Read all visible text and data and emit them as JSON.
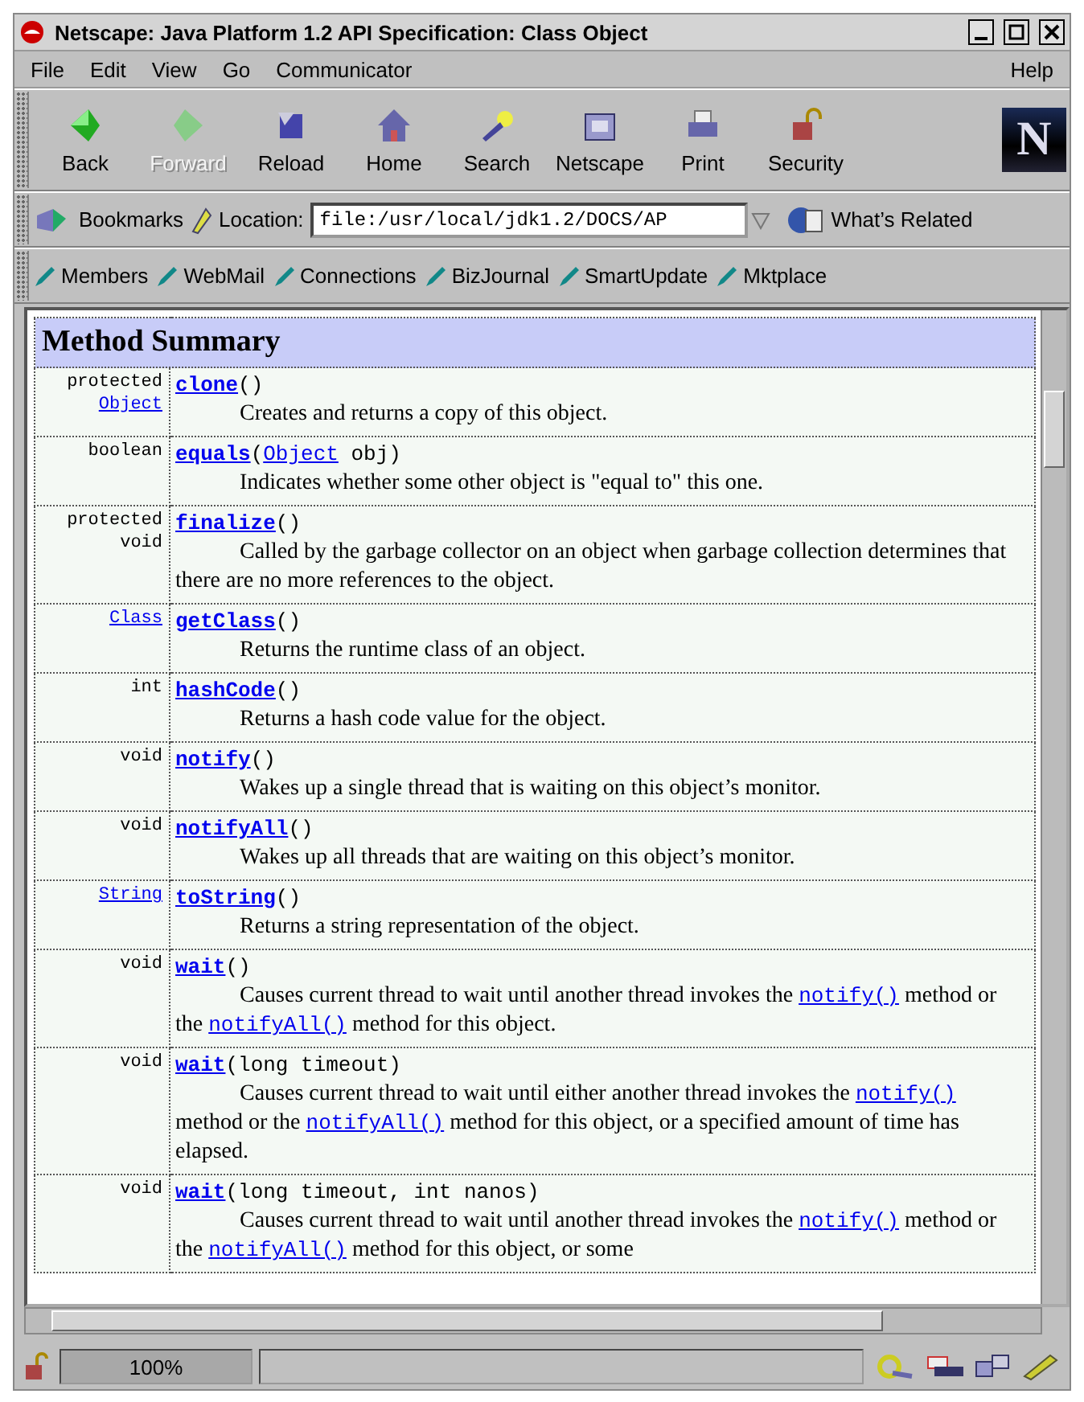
{
  "window": {
    "title": "Netscape: Java Platform 1.2 API Specification: Class Object"
  },
  "menu": [
    "File",
    "Edit",
    "View",
    "Go",
    "Communicator"
  ],
  "help_menu": "Help",
  "toolbar": [
    {
      "label": "Back",
      "disabled": false
    },
    {
      "label": "Forward",
      "disabled": true
    },
    {
      "label": "Reload",
      "disabled": false
    },
    {
      "label": "Home",
      "disabled": false
    },
    {
      "label": "Search",
      "disabled": false
    },
    {
      "label": "Netscape",
      "disabled": false
    },
    {
      "label": "Print",
      "disabled": false
    },
    {
      "label": "Security",
      "disabled": false
    }
  ],
  "logo": "N",
  "location_bar": {
    "bookmarks": "Bookmarks",
    "label": "Location:",
    "value": "file:/usr/local/jdk1.2/DOCS/AP",
    "related": "What’s Related"
  },
  "personal_toolbar": [
    "Members",
    "WebMail",
    "Connections",
    "BizJournal",
    "SmartUpdate",
    "Mktplace"
  ],
  "summary": {
    "title": "Method Summary",
    "rows": [
      {
        "modifier": [
          {
            "text": "protected",
            "link": false
          },
          {
            "text": "Object",
            "link": true
          }
        ],
        "name": "clone",
        "params": [
          {
            "text": "()",
            "link": false
          }
        ],
        "description": [
          {
            "text": "Creates and returns a copy of this object.",
            "link": false
          }
        ]
      },
      {
        "modifier": [
          {
            "text": "boolean",
            "link": false
          }
        ],
        "name": "equals",
        "params": [
          {
            "text": "(",
            "link": false
          },
          {
            "text": "Object",
            "link": true
          },
          {
            "text": " obj)",
            "link": false
          }
        ],
        "description": [
          {
            "text": "Indicates whether some other object is \"equal to\" this one.",
            "link": false
          }
        ]
      },
      {
        "modifier": [
          {
            "text": "protected",
            "link": false
          },
          {
            "text": "void",
            "link": false
          }
        ],
        "name": "finalize",
        "params": [
          {
            "text": "()",
            "link": false
          }
        ],
        "description": [
          {
            "text": "Called by the garbage collector on an object when garbage collection determines that there are no more references to the object.",
            "link": false
          }
        ]
      },
      {
        "modifier": [
          {
            "text": "Class",
            "link": true
          }
        ],
        "name": "getClass",
        "params": [
          {
            "text": "()",
            "link": false
          }
        ],
        "description": [
          {
            "text": "Returns the runtime class of an object.",
            "link": false
          }
        ]
      },
      {
        "modifier": [
          {
            "text": "int",
            "link": false
          }
        ],
        "name": "hashCode",
        "params": [
          {
            "text": "()",
            "link": false
          }
        ],
        "description": [
          {
            "text": "Returns a hash code value for the object.",
            "link": false
          }
        ]
      },
      {
        "modifier": [
          {
            "text": "void",
            "link": false
          }
        ],
        "name": "notify",
        "params": [
          {
            "text": "()",
            "link": false
          }
        ],
        "description": [
          {
            "text": "Wakes up a single thread that is waiting on this object’s monitor.",
            "link": false
          }
        ]
      },
      {
        "modifier": [
          {
            "text": "void",
            "link": false
          }
        ],
        "name": "notifyAll",
        "params": [
          {
            "text": "()",
            "link": false
          }
        ],
        "description": [
          {
            "text": "Wakes up all threads that are waiting on this object’s monitor.",
            "link": false
          }
        ]
      },
      {
        "modifier": [
          {
            "text": "String",
            "link": true
          }
        ],
        "name": "toString",
        "params": [
          {
            "text": "()",
            "link": false
          }
        ],
        "description": [
          {
            "text": "Returns a string representation of the object.",
            "link": false
          }
        ]
      },
      {
        "modifier": [
          {
            "text": "void",
            "link": false
          }
        ],
        "name": "wait",
        "params": [
          {
            "text": "()",
            "link": false
          }
        ],
        "description": [
          {
            "text": "Causes current thread to wait until another thread invokes the ",
            "link": false
          },
          {
            "text": "notify()",
            "link": true
          },
          {
            "text": " method or the ",
            "link": false
          },
          {
            "text": "notifyAll()",
            "link": true
          },
          {
            "text": " method for this object.",
            "link": false
          }
        ]
      },
      {
        "modifier": [
          {
            "text": "void",
            "link": false
          }
        ],
        "name": "wait",
        "params": [
          {
            "text": "(long timeout)",
            "link": false
          }
        ],
        "description": [
          {
            "text": "Causes current thread to wait until either another thread invokes the ",
            "link": false
          },
          {
            "text": "notify()",
            "link": true
          },
          {
            "text": " method or the ",
            "link": false
          },
          {
            "text": "notifyAll()",
            "link": true
          },
          {
            "text": " method for this object, or a specified amount of time has elapsed.",
            "link": false
          }
        ]
      },
      {
        "modifier": [
          {
            "text": "void",
            "link": false
          }
        ],
        "name": "wait",
        "params": [
          {
            "text": "(long timeout, int nanos)",
            "link": false
          }
        ],
        "description": [
          {
            "text": "Causes current thread to wait until another thread invokes the ",
            "link": false
          },
          {
            "text": "notify()",
            "link": true
          },
          {
            "text": " method or the ",
            "link": false
          },
          {
            "text": "notifyAll()",
            "link": true
          },
          {
            "text": " method for this object, or some",
            "link": false
          }
        ]
      }
    ]
  },
  "status_bar": {
    "zoom": "100%"
  }
}
